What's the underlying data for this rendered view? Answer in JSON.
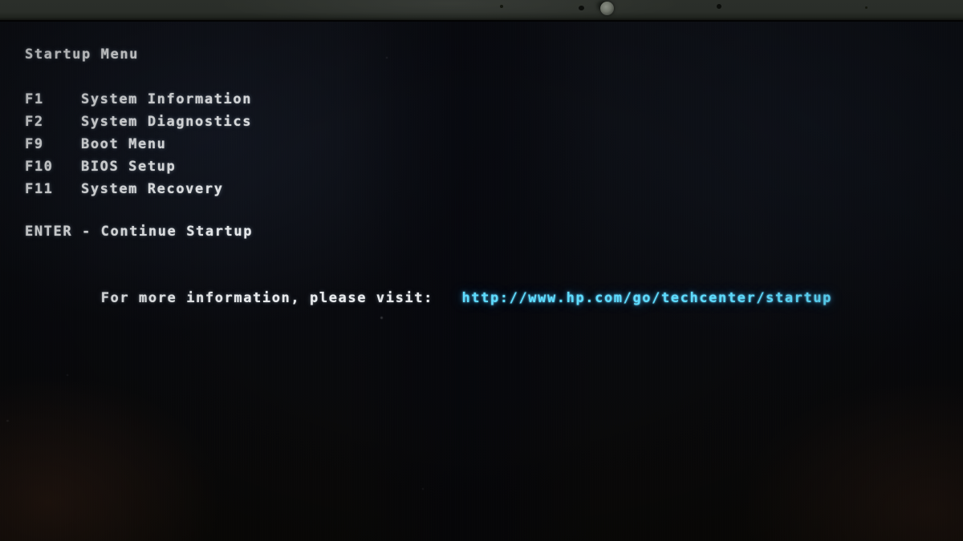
{
  "screen": {
    "title": "Startup Menu",
    "menu_items": [
      {
        "key": "F1",
        "label": "System Information"
      },
      {
        "key": "F2",
        "label": "System Diagnostics"
      },
      {
        "key": "F9",
        "label": "Boot Menu"
      },
      {
        "key": "F10",
        "label": "BIOS Setup"
      },
      {
        "key": "F11",
        "label": "System Recovery"
      }
    ],
    "continue_line": "ENTER - Continue Startup",
    "info_prefix": "For more information, please visit:",
    "info_url": "http://www.hp.com/go/techcenter/startup"
  },
  "colors": {
    "text": "#e8eaec",
    "url": "#5ddcff",
    "screen_background": "#0b0d12",
    "bezel": "#2a2e29"
  },
  "hardware": {
    "bezel_label": "laptop-top-bezel",
    "webcam_label": "webcam-lens"
  }
}
